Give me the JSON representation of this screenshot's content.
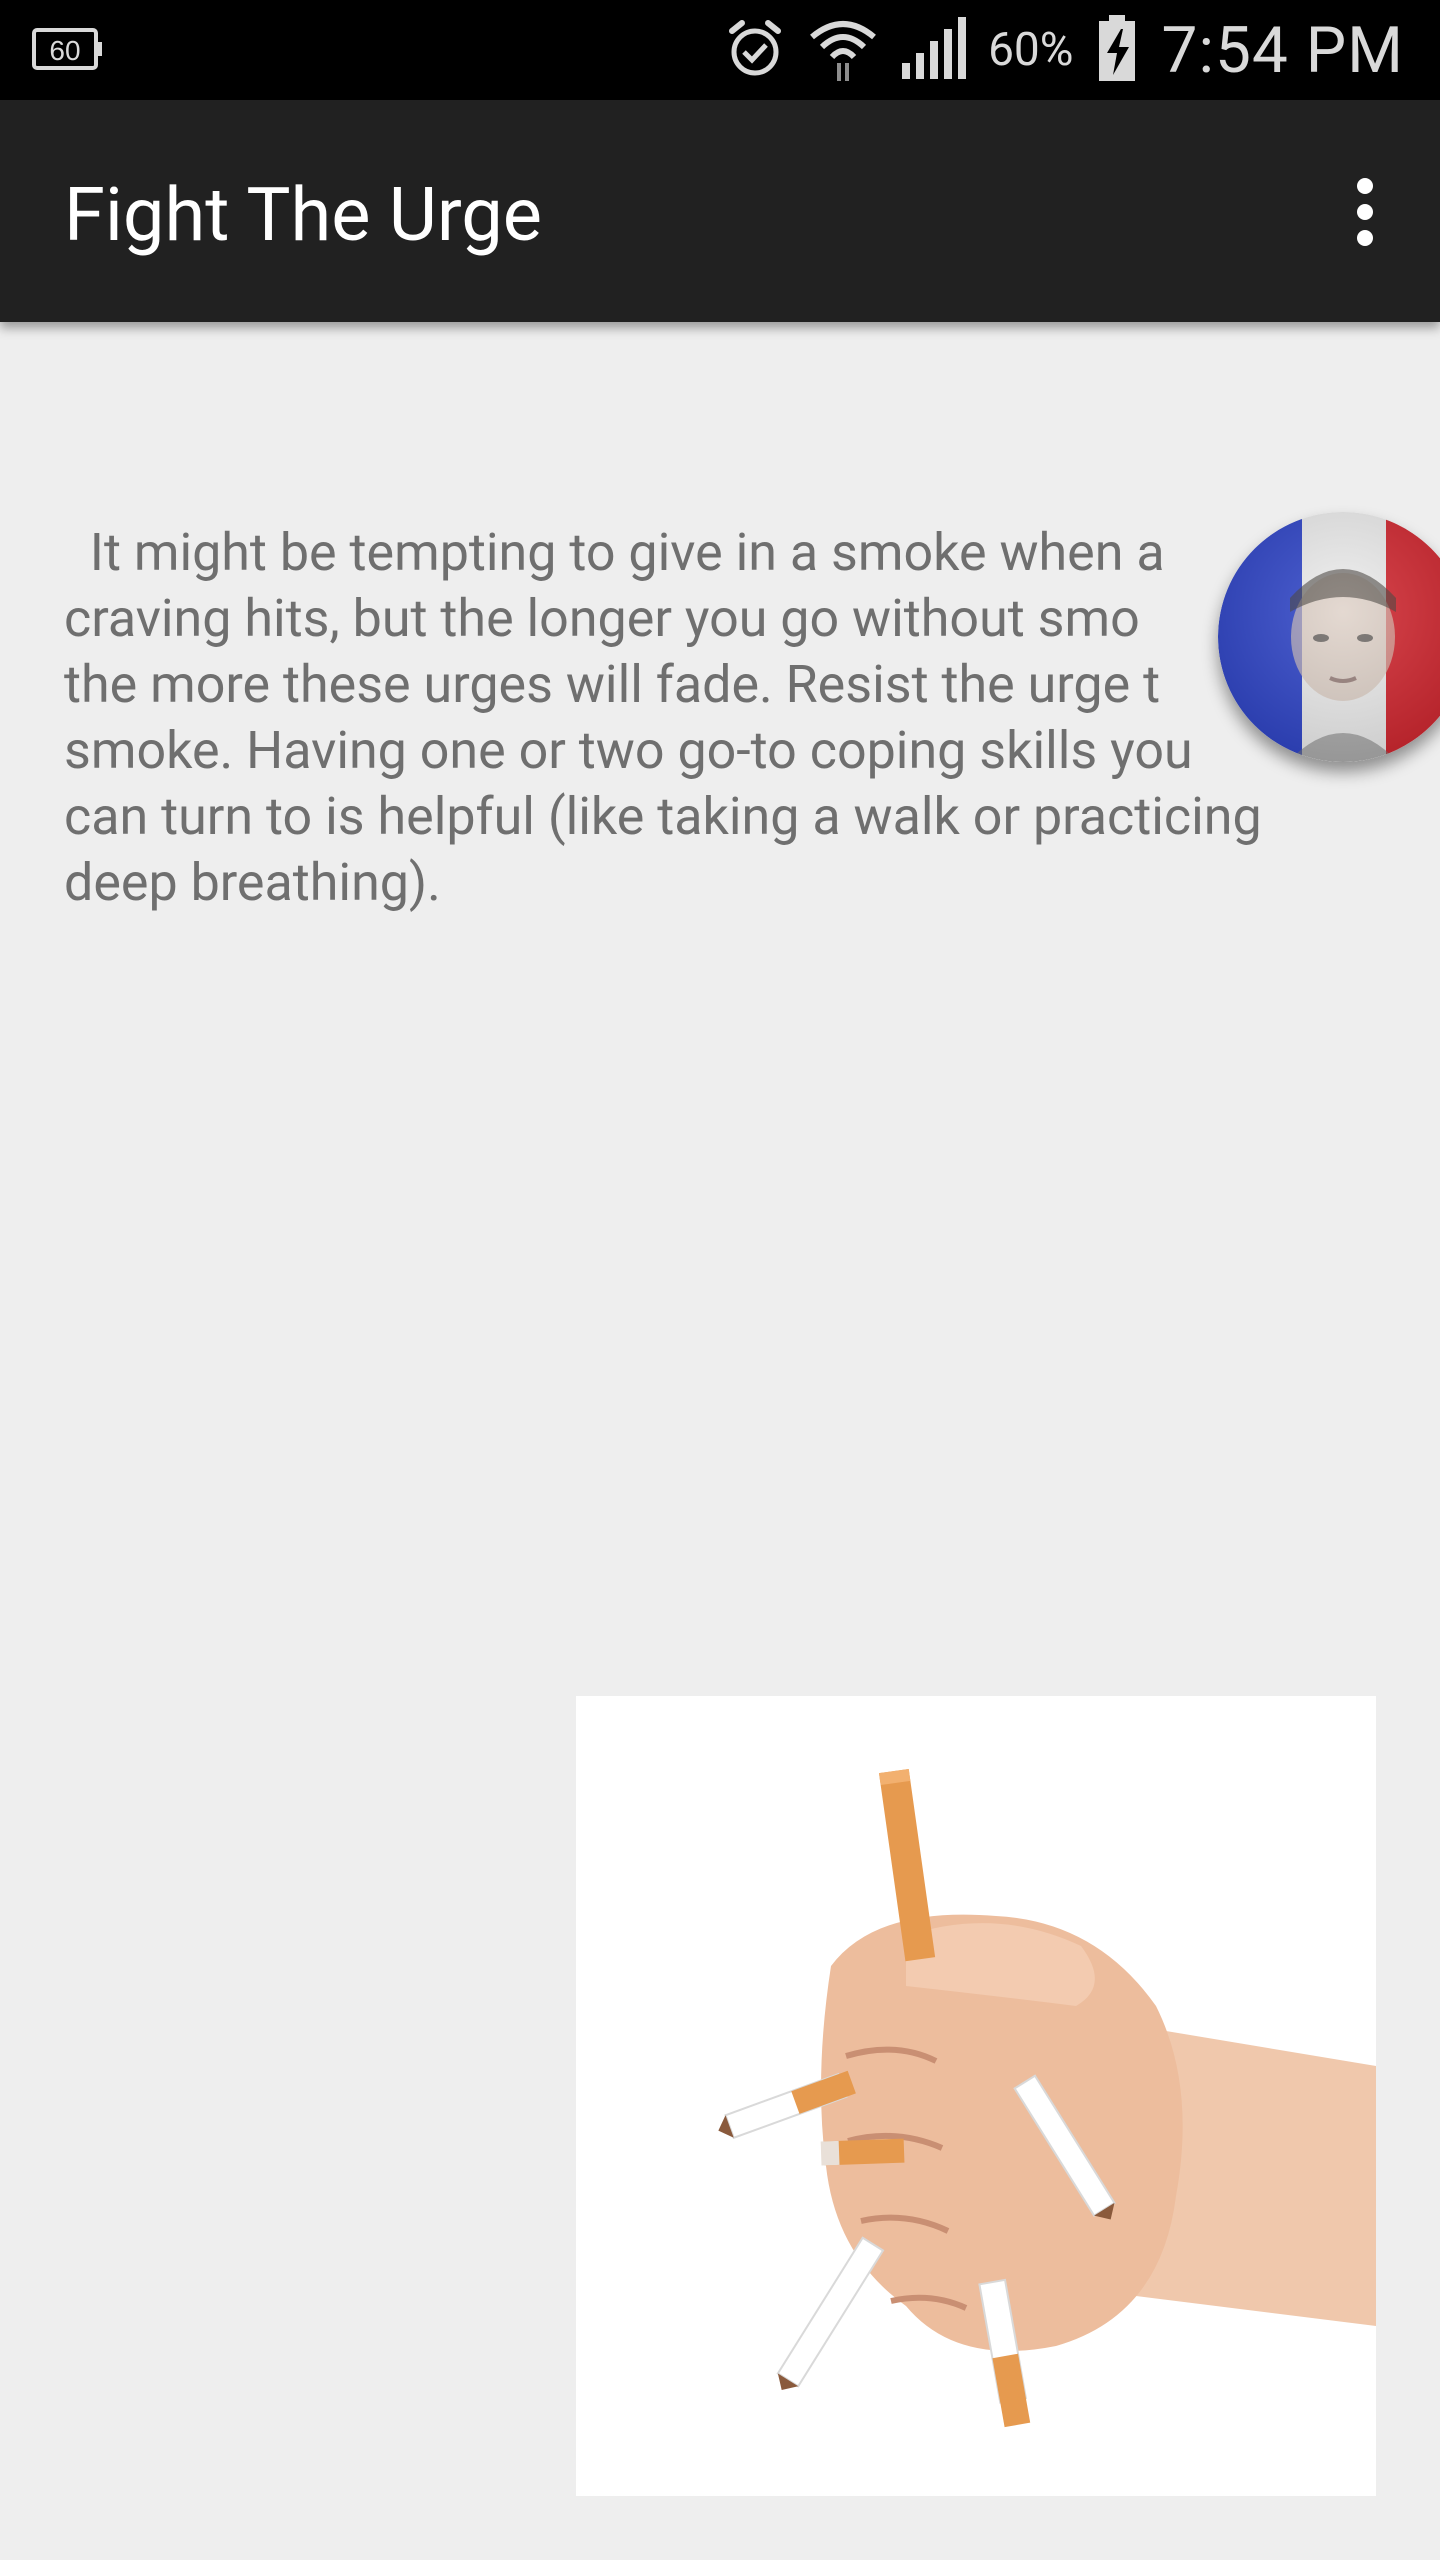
{
  "status_bar": {
    "left_icon": "notification-60-icon",
    "alarm_icon": "alarm-icon",
    "wifi_icon": "wifi-icon",
    "signal_icon": "signal-icon",
    "battery_percent": "60%",
    "battery_icon": "battery-charging-icon",
    "time": "7:54 PM"
  },
  "app_bar": {
    "title": "Fight The Urge",
    "overflow_icon": "more-vert-icon"
  },
  "content": {
    "paragraph": "  It might be tempting to give in a smoke when a\ncraving hits, but the longer you go without smo\nthe more these urges will fade. Resist the urge t\nsmoke. Having one or two go-to coping skills you\ncan turn to is helpful (like taking a walk or practicing\ndeep breathing)."
  },
  "floating_badge": {
    "icon": "flag-avatar-icon",
    "colors": {
      "blue": "#2f45c9",
      "white": "#f0f0f0",
      "red": "#d2262f"
    }
  },
  "image": {
    "icon": "hand-crushing-cigarettes-illustration"
  }
}
